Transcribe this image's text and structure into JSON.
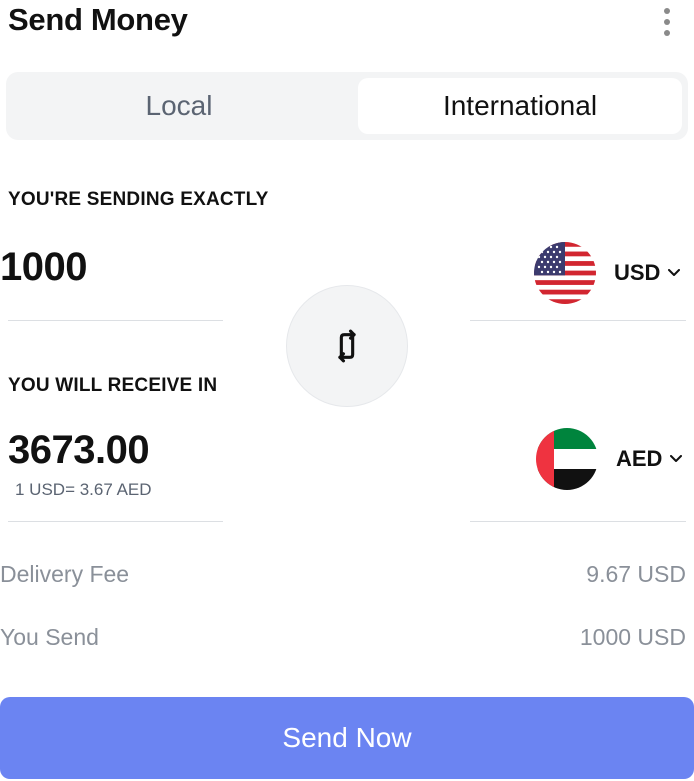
{
  "header": {
    "title": "Send Money",
    "menu_icon": "more-vertical-icon"
  },
  "tabs": {
    "local_label": "Local",
    "international_label": "International",
    "selected": "International"
  },
  "sending": {
    "label": "YOU'RE SENDING EXACTLY",
    "amount": "1000",
    "currency": "USD",
    "flag_icon": "us-flag-icon"
  },
  "swap": {
    "icon": "swap-arrows-icon"
  },
  "receiving": {
    "label": "YOU WILL RECEIVE IN",
    "amount": "3673.00",
    "rate": "1 USD= 3.67 AED",
    "currency": "AED",
    "flag_icon": "uae-flag-icon"
  },
  "summary": {
    "delivery_fee_label": "Delivery Fee",
    "delivery_fee_value": "9.67 USD",
    "you_send_label": "You Send",
    "you_send_value": "1000 USD"
  },
  "action": {
    "send_label": "Send Now"
  },
  "colors": {
    "primary_button": "#6b84f2",
    "segment_background": "#f3f4f5",
    "muted_text": "#8a9099"
  }
}
